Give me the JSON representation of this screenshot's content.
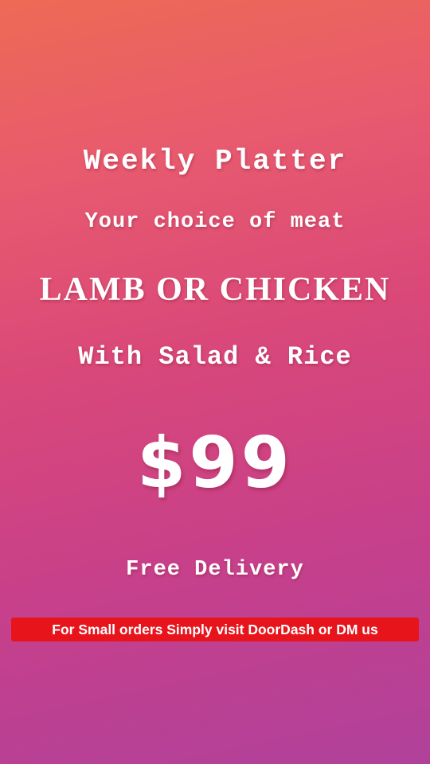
{
  "story": {
    "title": "Weekly Platter",
    "subtitle": "Your choice of meat",
    "meat_options": "LAMB OR CHICKEN",
    "sides": "With Salad & Rice",
    "price": "$99",
    "delivery": "Free Delivery",
    "banner_text": "For Small orders Simply visit DoorDash or DM us"
  },
  "colors": {
    "background_top": "#ee6a55",
    "background_bottom": "#b0419a",
    "banner": "#e8141c",
    "text": "#ffffff"
  }
}
